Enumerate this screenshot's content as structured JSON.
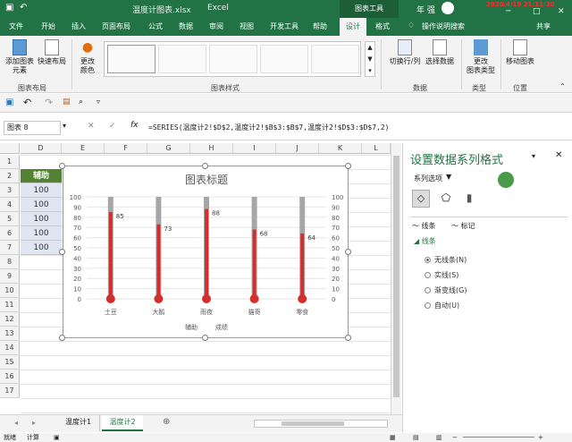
{
  "title_bar": {
    "filename": "温度计图表.xlsx",
    "app": "Excel",
    "context_tab": "图表工具",
    "user": "年 强",
    "datetime": "2020/4/19 21:11:20",
    "minimize": "─",
    "restore": "□",
    "close": "✕"
  },
  "tabs": [
    "文件",
    "开始",
    "插入",
    "页面布局",
    "公式",
    "数据",
    "审阅",
    "视图",
    "开发工具",
    "帮助",
    "设计",
    "格式"
  ],
  "tell_me": "操作说明搜索",
  "share": "共享",
  "ribbon": {
    "add_element": "添加图表\n元素",
    "quick_layout": "快速布局",
    "change_colors": "更改\n颜色",
    "switch_row_col": "切换行/列",
    "select_data": "选择数据",
    "change_type": "更改\n图表类型",
    "move_chart": "移动图表",
    "groups": {
      "layout": "图表布局",
      "styles": "图表样式",
      "data": "数据",
      "type": "类型",
      "location": "位置"
    }
  },
  "name_box": "图表 8",
  "formula": "=SERIES(温度计2!$D$2,温度计2!$B$3:$B$7,温度计2!$D$3:$D$7,2)",
  "columns": [
    "D",
    "E",
    "F",
    "G",
    "H",
    "I",
    "J",
    "K",
    "L"
  ],
  "rows": [
    "1",
    "2",
    "3",
    "4",
    "5",
    "6",
    "7",
    "8",
    "9",
    "10",
    "11",
    "12",
    "13",
    "14",
    "15",
    "16",
    "17"
  ],
  "cells": {
    "header": "辅助",
    "values": [
      "100",
      "100",
      "100",
      "100",
      "100"
    ]
  },
  "chart_data": {
    "type": "bar",
    "title": "图表标题",
    "categories": [
      "土豆",
      "大鹅",
      "雨夜",
      "猫哥",
      "零食"
    ],
    "series": [
      {
        "name": "辅助",
        "values": [
          100,
          100,
          100,
          100,
          100
        ],
        "color": "#a6a6a6"
      },
      {
        "name": "成绩",
        "values": [
          85,
          73,
          88,
          68,
          64
        ],
        "color": "#d32f2f"
      }
    ],
    "yticks": [
      "100",
      "90",
      "80",
      "70",
      "60",
      "50",
      "40",
      "30",
      "20",
      "10",
      "0"
    ],
    "ylim": [
      0,
      100
    ],
    "grid": true,
    "legend": "bottom"
  },
  "pane": {
    "title": "设置数据系列格式",
    "series_options": "系列选项",
    "line_tab": "线条",
    "marker_tab": "标记",
    "line_section": "线条",
    "options": [
      "无线条(N)",
      "实线(S)",
      "渐变线(G)",
      "自动(U)"
    ],
    "close": "✕"
  },
  "sheets": [
    "温度计1",
    "温度计2"
  ],
  "status": {
    "ready": "就绪",
    "calc": "计算"
  }
}
